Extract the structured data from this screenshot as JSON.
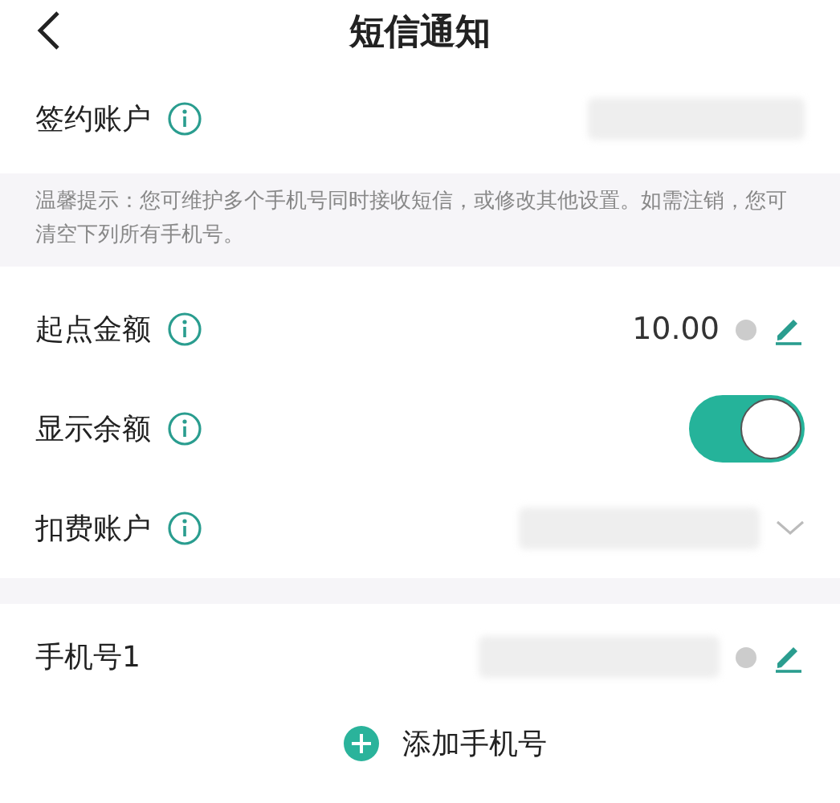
{
  "header": {
    "title": "短信通知"
  },
  "account": {
    "label": "签约账户",
    "masked": true
  },
  "tip": "温馨提示：您可维护多个手机号同时接收短信，或修改其他设置。如需注销，您可清空下列所有手机号。",
  "settings": [
    {
      "kind": "value",
      "label": "起点金额",
      "value": "10.00"
    },
    {
      "kind": "toggle",
      "label": "显示余额",
      "on": true
    },
    {
      "kind": "select",
      "label": "扣费账户",
      "masked": true
    }
  ],
  "phones": [
    {
      "label": "手机号1",
      "masked": true
    }
  ],
  "add_button": "添加手机号"
}
